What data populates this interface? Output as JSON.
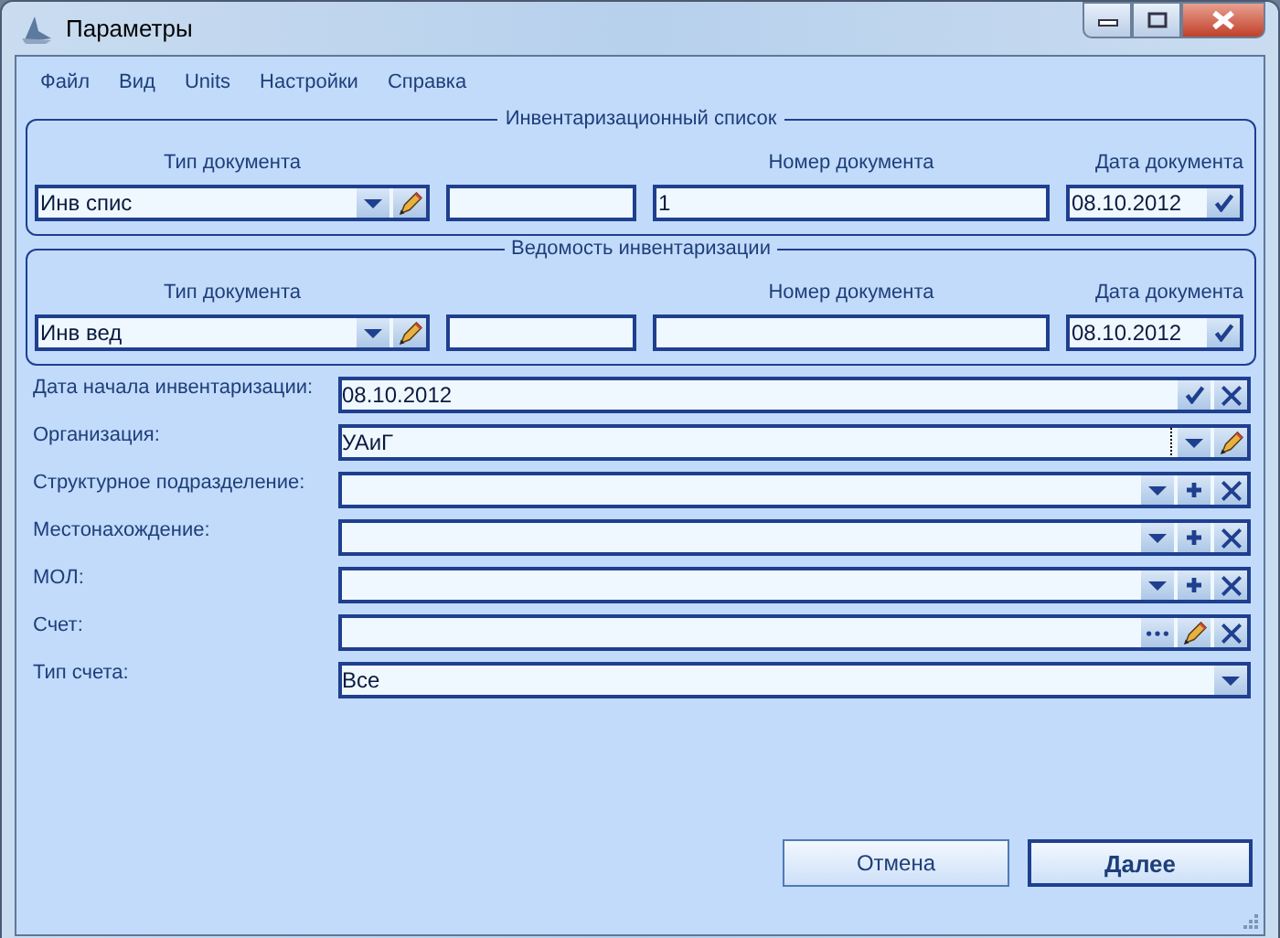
{
  "window": {
    "title": "Параметры"
  },
  "menu": [
    "Файл",
    "Вид",
    "Units",
    "Настройки",
    "Справка"
  ],
  "groups": [
    {
      "title": "Инвентаризационный список",
      "type_label": "Тип документа",
      "type_value": "Инв спис",
      "number_label": "Номер документа",
      "number_value": "1",
      "date_label": "Дата документа",
      "date_value": "08.10.2012"
    },
    {
      "title": "Ведомость инвентаризации",
      "type_label": "Тип документа",
      "type_value": "Инв вед",
      "number_label": "Номер документа",
      "date_label": "Дата документа",
      "date_value": "08.10.2012"
    }
  ],
  "fields": [
    {
      "label": "Дата начала инвентаризации:",
      "value": "08.10.2012",
      "focused": false,
      "buttons": [
        {
          "kind": "check"
        },
        {
          "kind": "clear"
        }
      ]
    },
    {
      "label": "Организация:",
      "value": "УАиГ",
      "focused": true,
      "buttons": [
        {
          "kind": "dropdown"
        },
        {
          "kind": "edit"
        }
      ]
    },
    {
      "label": "Структурное подразделение:",
      "focused": false,
      "buttons": [
        {
          "kind": "dropdown"
        },
        {
          "kind": "add"
        },
        {
          "kind": "clear"
        }
      ]
    },
    {
      "label": "Местонахождение:",
      "focused": false,
      "buttons": [
        {
          "kind": "dropdown"
        },
        {
          "kind": "add"
        },
        {
          "kind": "clear"
        }
      ]
    },
    {
      "label": "МОЛ:",
      "focused": false,
      "buttons": [
        {
          "kind": "dropdown"
        },
        {
          "kind": "add"
        },
        {
          "kind": "clear"
        }
      ]
    },
    {
      "label": "Счет:",
      "focused": false,
      "buttons": [
        {
          "kind": "more"
        },
        {
          "kind": "edit"
        },
        {
          "kind": "clear"
        }
      ]
    },
    {
      "label": "Тип счета:",
      "value": "Все",
      "focused": false,
      "buttons": [
        {
          "kind": "dropdown"
        }
      ]
    }
  ],
  "buttons": [
    {
      "label": "Отмена",
      "default": false
    },
    {
      "label": "Далее",
      "default": true
    }
  ]
}
